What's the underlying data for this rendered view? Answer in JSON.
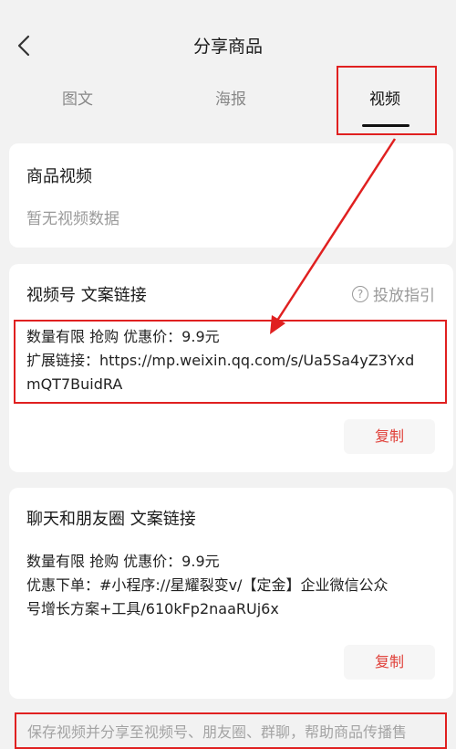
{
  "header": {
    "title": "分享商品"
  },
  "tabs": [
    {
      "label": "图文"
    },
    {
      "label": "海报"
    },
    {
      "label": "视频"
    }
  ],
  "video_card": {
    "title": "商品视频",
    "empty_text": "暂无视频数据"
  },
  "channels_card": {
    "title": "视频号 文案链接",
    "guide_label": "投放指引",
    "line1": "数量有限 抢购 优惠价：9.9元",
    "line2": "扩展链接：https://mp.weixin.qq.com/s/Ua5Sa4yZ3Yxd",
    "line3": "mQT7BuidRA",
    "copy_label": "复制"
  },
  "chat_card": {
    "title": "聊天和朋友圈 文案链接",
    "line1": "数量有限 抢购 优惠价：9.9元",
    "line2": "优惠下单：#小程序://星耀裂变v/【定金】企业微信公众",
    "line3": "号增长方案+工具/610kFp2naaRUj6x",
    "copy_label": "复制"
  },
  "bottom_note": "保存视频并分享至视频号、朋友圈、群聊，帮助商品传播售",
  "colors": {
    "annotation": "#e02020",
    "copy_text": "#e0413a",
    "background": "#f2f2f2"
  }
}
